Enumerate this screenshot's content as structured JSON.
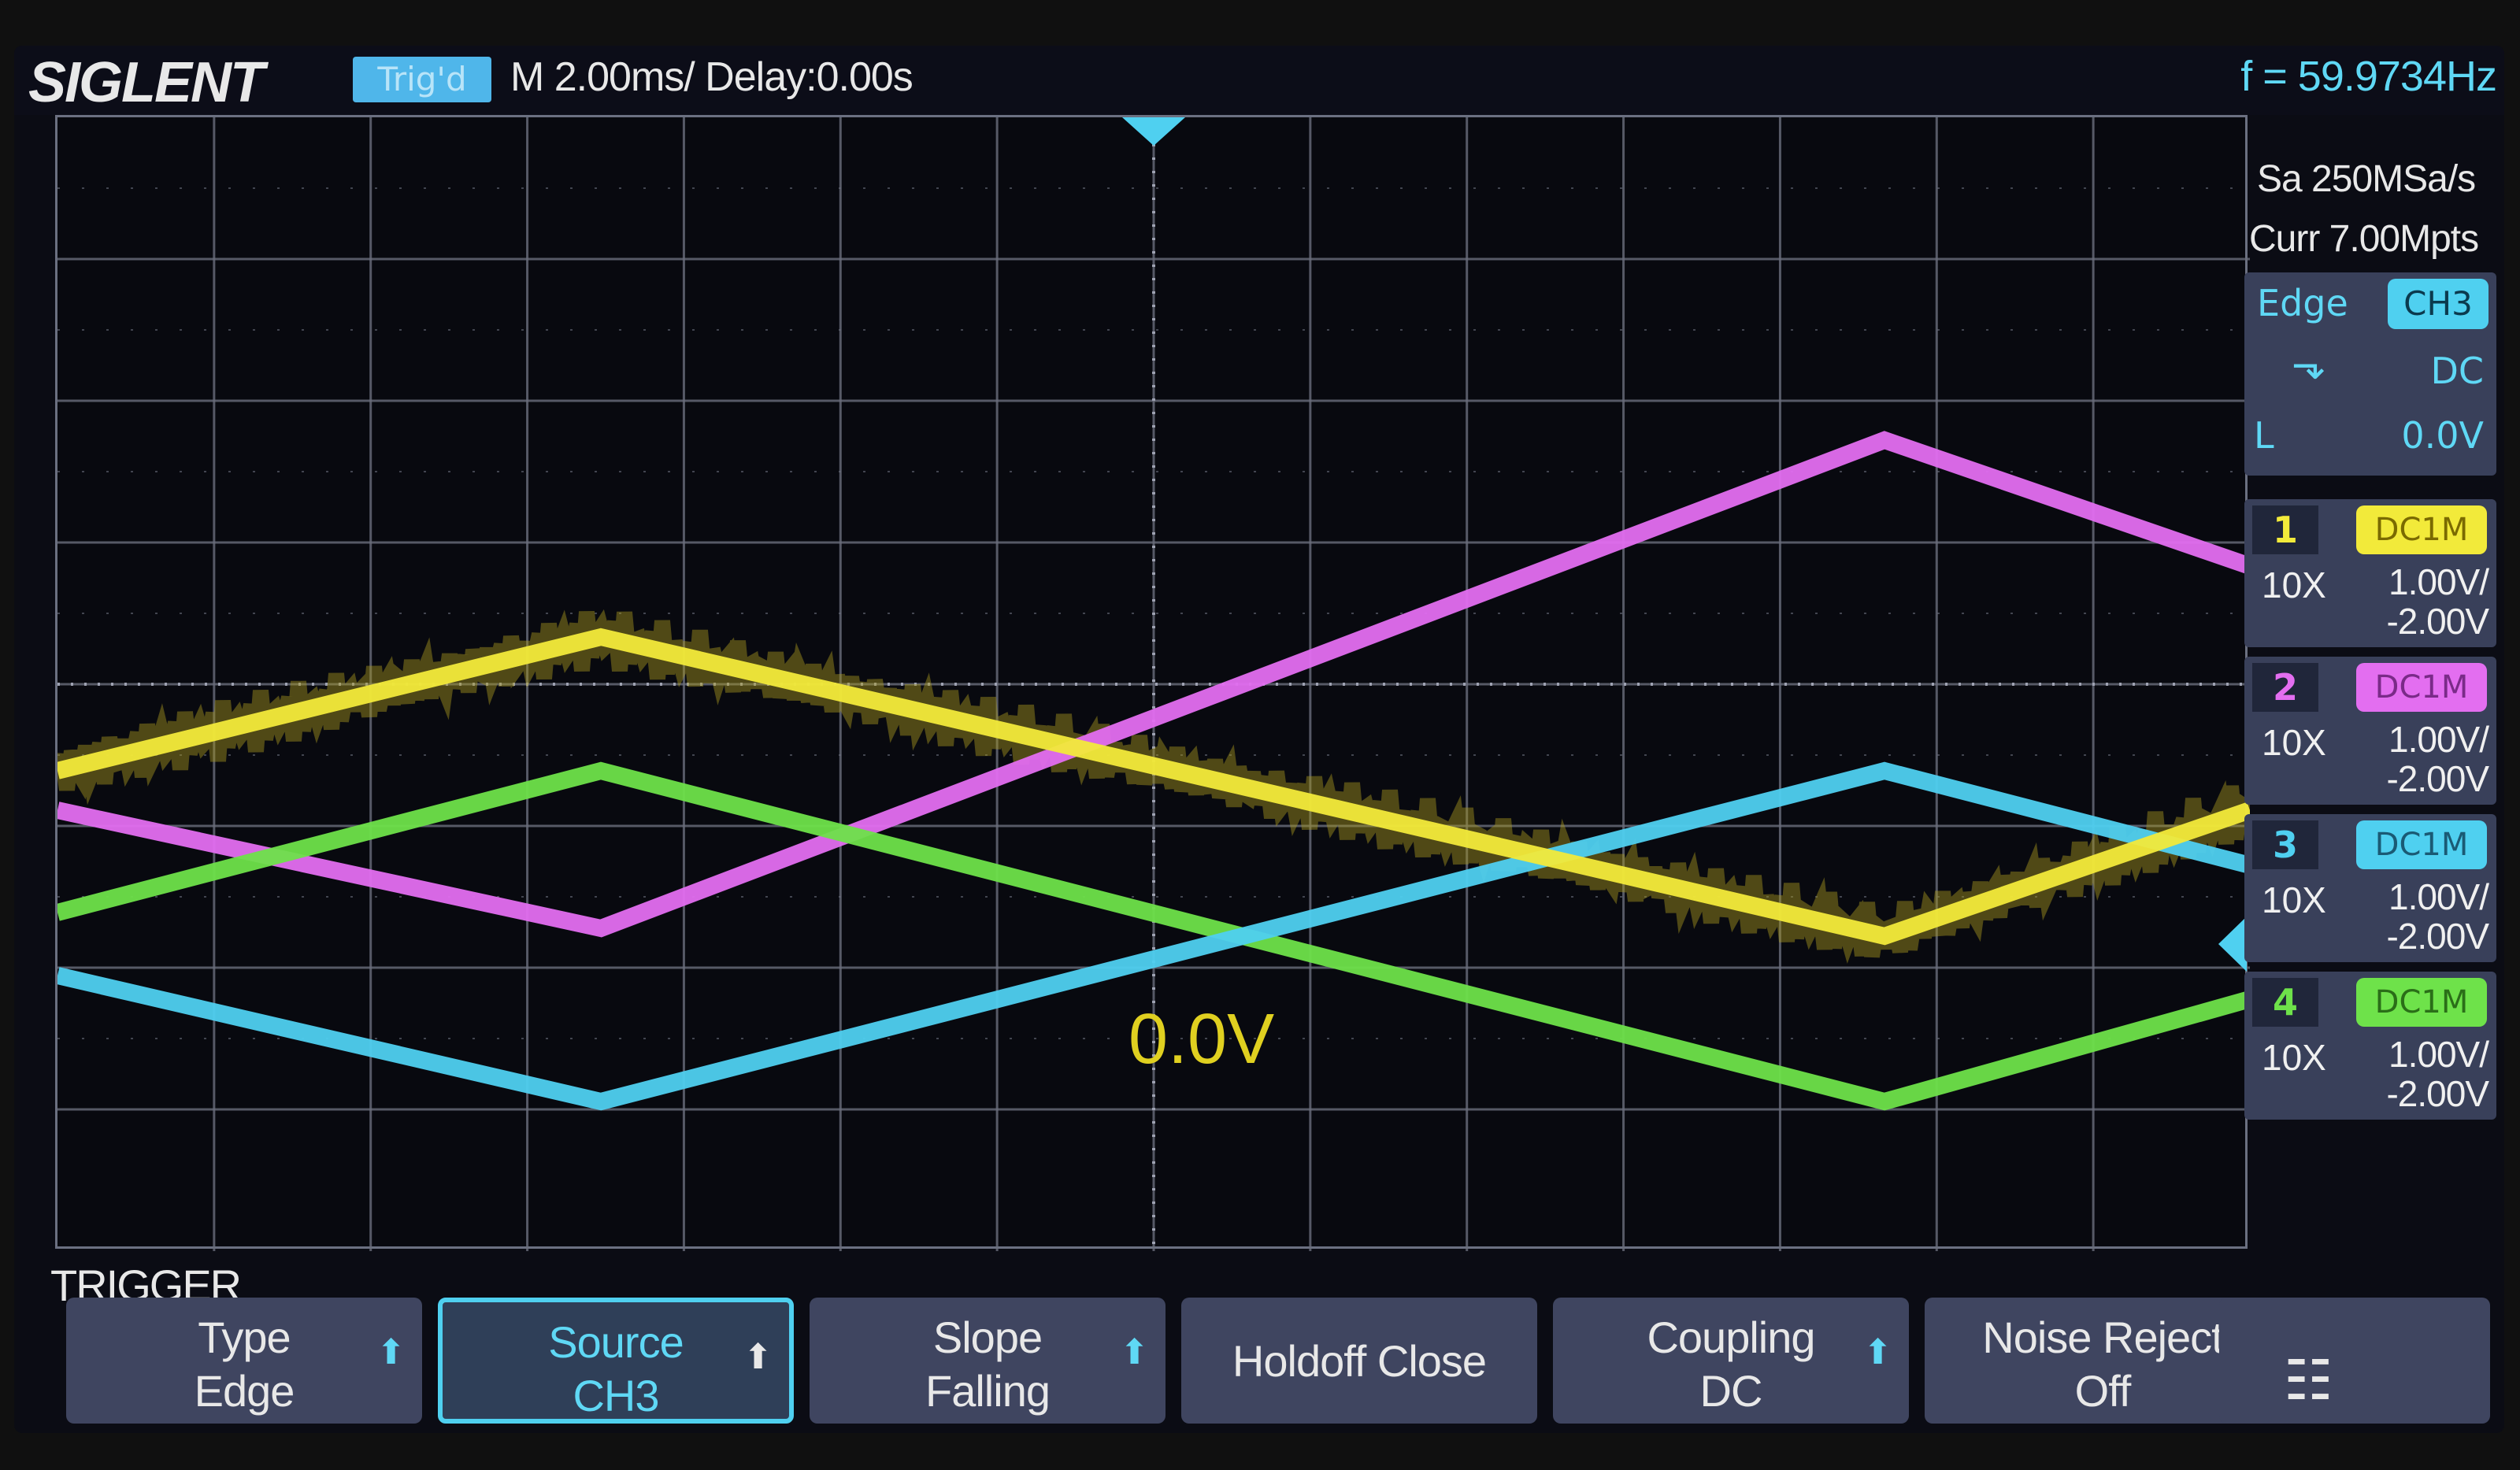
{
  "header": {
    "logo": "SIGLENT",
    "trig_status": "Trig'd",
    "timebase": "M 2.00ms/ Delay:0.00s",
    "frequency": "f = 59.9734Hz"
  },
  "acquisition": {
    "sample_rate": "Sa 250MSa/s",
    "memory": "Curr 7.00Mpts"
  },
  "trigger_panel": {
    "type": "Edge",
    "source": "CH3",
    "slope_symbol": "⬎",
    "coupling": "DC",
    "level_label": "L",
    "level": "0.0V"
  },
  "channels": [
    {
      "num": "1",
      "coupling": "DC1M",
      "probe": "10X",
      "scale": "1.00V/",
      "offset": "-2.00V",
      "color": "#f2ea3a",
      "cpl_text": "#7a6a00"
    },
    {
      "num": "2",
      "coupling": "DC1M",
      "probe": "10X",
      "scale": "1.00V/",
      "offset": "-2.00V",
      "color": "#e36ef0",
      "cpl_text": "#7a2a88"
    },
    {
      "num": "3",
      "coupling": "DC1M",
      "probe": "10X",
      "scale": "1.00V/",
      "offset": "-2.00V",
      "color": "#4fd0f0",
      "cpl_text": "#1a5a74"
    },
    {
      "num": "4",
      "coupling": "DC1M",
      "probe": "10X",
      "scale": "1.00V/",
      "offset": "-2.00V",
      "color": "#6ee24a",
      "cpl_text": "#2a6e18"
    }
  ],
  "plot": {
    "level_label": "0.0V",
    "ch3_marker": "3"
  },
  "menu": {
    "title": "TRIGGER",
    "buttons": [
      {
        "line1": "Type",
        "line2": "Edge",
        "arrow": "⬆",
        "selected": false
      },
      {
        "line1": "Source",
        "line2": "CH3",
        "arrow": "⬆",
        "selected": true
      },
      {
        "line1": "Slope",
        "line2": "Falling",
        "arrow": "⬆",
        "selected": false
      },
      {
        "line1": "Holdoff Close",
        "line2": "",
        "arrow": "",
        "selected": false
      },
      {
        "line1": "Coupling",
        "line2": "DC",
        "arrow": "⬆",
        "selected": false
      },
      {
        "line1": "Noise Reject",
        "line2": "Off",
        "arrow": "",
        "selected": false
      }
    ],
    "network_icon": "network-icon"
  },
  "colors": {
    "grid": "#6a6e7c",
    "border": "#6b7081",
    "panel": "#39405a"
  }
}
